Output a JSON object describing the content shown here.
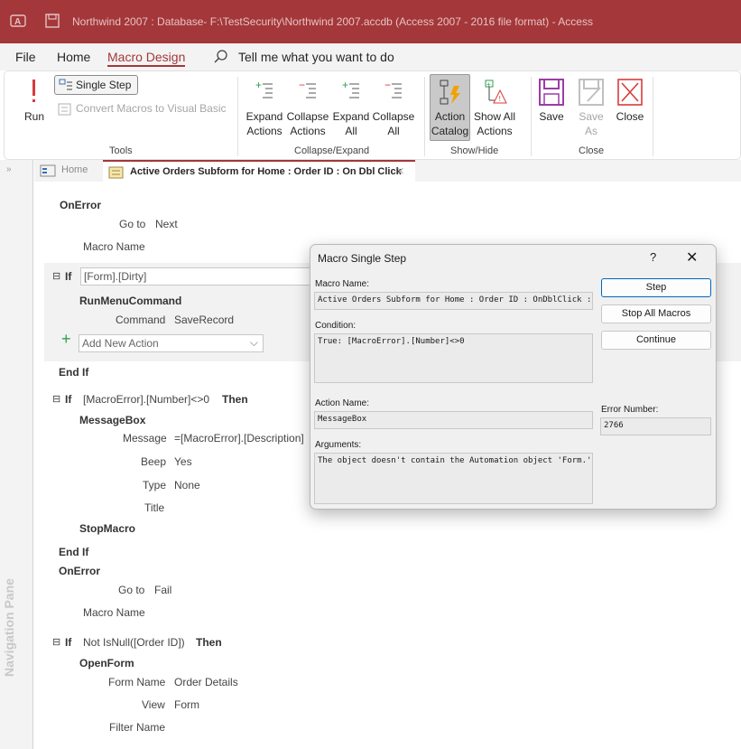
{
  "titlebar": {
    "title": "Northwind 2007 : Database- F:\\TestSecurity\\Northwind 2007.accdb (Access 2007 - 2016 file format)  -  Access"
  },
  "menu": {
    "items": [
      "File",
      "Home",
      "Macro Design"
    ],
    "active": "Macro Design",
    "tell_me": "Tell me what you want to do"
  },
  "ribbon": {
    "run_label": "Run",
    "single_step_label": "Single Step",
    "convert_label": "Convert Macros to Visual Basic",
    "tools_group": "Tools",
    "expand_actions": [
      "Expand",
      "Actions"
    ],
    "collapse_actions": [
      "Collapse",
      "Actions"
    ],
    "expand_all": [
      "Expand",
      "All"
    ],
    "collapse_all": [
      "Collapse",
      "All"
    ],
    "collapse_expand_group": "Collapse/Expand",
    "action_catalog": [
      "Action",
      "Catalog"
    ],
    "show_all_actions": [
      "Show All",
      "Actions"
    ],
    "show_hide_group": "Show/Hide",
    "save_label": "Save",
    "save_as": [
      "Save",
      "As"
    ],
    "close_label": "Close",
    "close_group": "Close"
  },
  "nav_pane": {
    "label": "Navigation Pane"
  },
  "tabs": {
    "home": "Home",
    "active": "Active Orders Subform for Home : Order ID : On Dbl Click"
  },
  "macro": {
    "onerror1": {
      "keyword": "OnError",
      "goto_label": "Go to",
      "goto_value": "Next",
      "macro_name_label": "Macro Name"
    },
    "if1": {
      "keyword": "If",
      "condition": "[Form].[Dirty]"
    },
    "runmenu": {
      "name": "RunMenuCommand",
      "command_label": "Command",
      "command_value": "SaveRecord"
    },
    "add_new_action": "Add New Action",
    "endif": "End If",
    "if2": {
      "keyword": "If",
      "condition": "[MacroError].[Number]<>0",
      "then": "Then"
    },
    "messagebox": {
      "name": "MessageBox",
      "message_label": "Message",
      "message_value": "=[MacroError].[Description]",
      "beep_label": "Beep",
      "beep_value": "Yes",
      "type_label": "Type",
      "type_value": "None",
      "title_label": "Title"
    },
    "stopmacro": "StopMacro",
    "onerror2": {
      "keyword": "OnError",
      "goto_label": "Go to",
      "goto_value": "Fail",
      "macro_name_label": "Macro Name"
    },
    "if3": {
      "keyword": "If",
      "condition": "Not IsNull([Order ID])",
      "then": "Then"
    },
    "openform": {
      "name": "OpenForm",
      "form_name_label": "Form Name",
      "form_name_value": "Order Details",
      "view_label": "View",
      "view_value": "Form",
      "filter_label": "Filter Name"
    }
  },
  "dialog": {
    "title": "Macro Single Step",
    "help": "?",
    "close": "✕",
    "macro_name_label": "Macro Name:",
    "macro_name_value": "Active Orders Subform for Home : Order ID : OnDblClick : Embedded Macro",
    "condition_label": "Condition:",
    "condition_value": "True: [MacroError].[Number]<>0",
    "action_name_label": "Action Name:",
    "action_name_value": "MessageBox",
    "arguments_label": "Arguments:",
    "arguments_value": "The object doesn't contain the Automation object 'Form.', Yes, None, ",
    "error_number_label": "Error Number:",
    "error_number_value": "2766",
    "buttons": {
      "step": "Step",
      "stop_all": "Stop All Macros",
      "continue": "Continue"
    }
  }
}
